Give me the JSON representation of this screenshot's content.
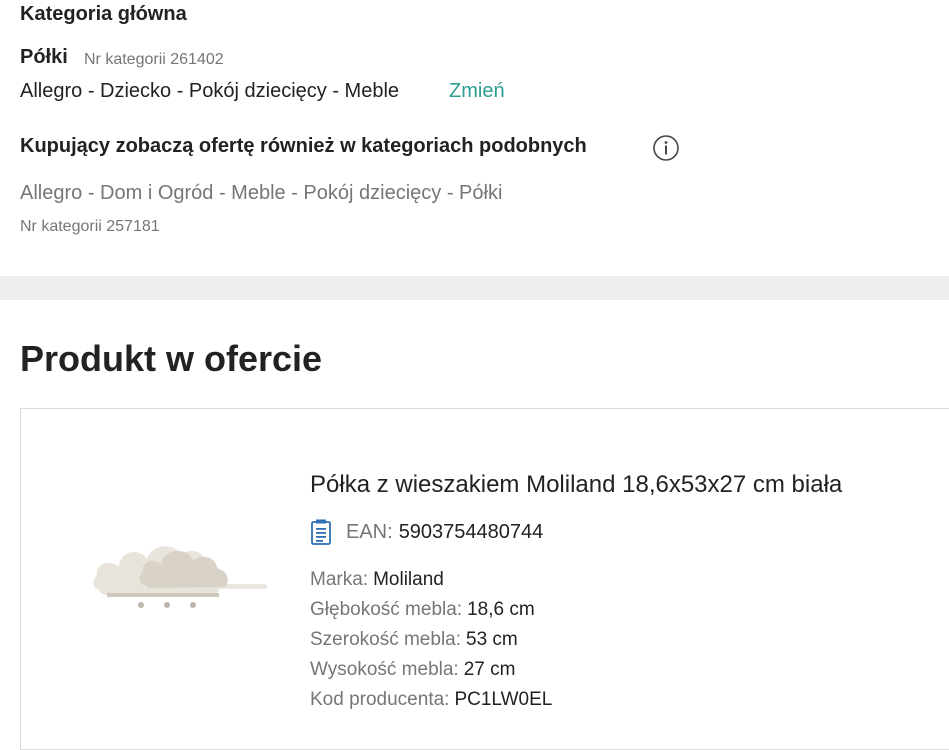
{
  "category": {
    "main_heading": "Kategoria główna",
    "name": "Półki",
    "number_text": "Nr kategorii 261402",
    "path": "Allegro - Dziecko - Pokój dziecięcy - Meble",
    "change_label": "Zmień"
  },
  "similar": {
    "heading": "Kupujący zobaczą ofertę również w kategoriach podobnych",
    "info_icon": "info-icon",
    "path": "Allegro - Dom i Ogród - Meble - Pokój dziecięcy - Półki",
    "number_text": "Nr kategorii 257181"
  },
  "product": {
    "heading": "Produkt w ofercie",
    "title": "Półka z wieszakiem Moliland 18,6x53x27 cm biała",
    "ean_icon": "barcode-document-icon",
    "ean_label": "EAN:",
    "ean_value": "5903754480744",
    "params": [
      {
        "label": "Marka:",
        "value": "Moliland"
      },
      {
        "label": "Głębokość mebla:",
        "value": "18,6 cm"
      },
      {
        "label": "Szerokość mebla:",
        "value": "53 cm"
      },
      {
        "label": "Wysokość mebla:",
        "value": "27 cm"
      },
      {
        "label": "Kod producenta:",
        "value": "PC1LW0EL"
      }
    ]
  },
  "colors": {
    "accent": "#2a9d8f",
    "muted_text": "#767676",
    "divider": "#eceeef"
  }
}
